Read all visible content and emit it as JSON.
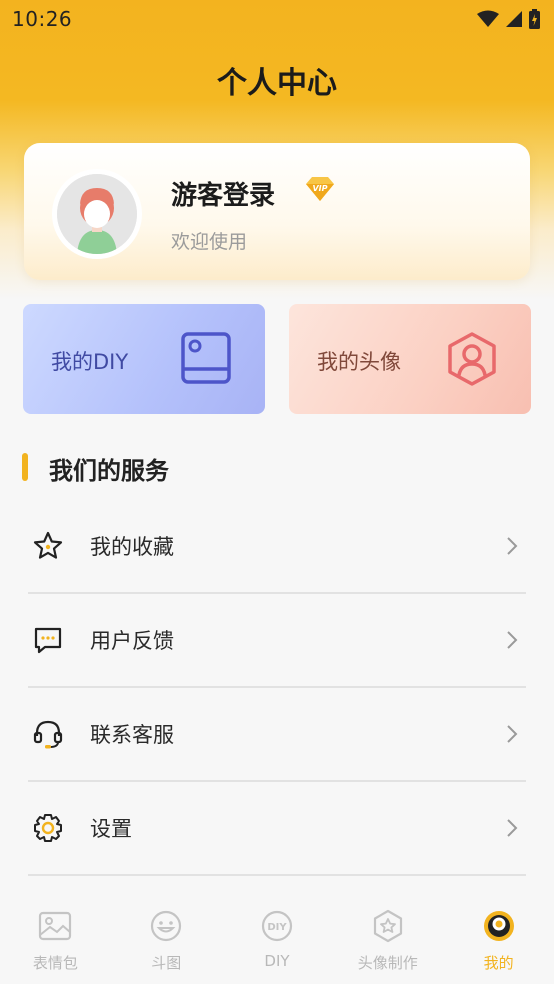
{
  "status_bar": {
    "time": "10:26"
  },
  "header": {
    "title": "个人中心"
  },
  "profile": {
    "name": "游客登录",
    "badge": "VIP",
    "subtitle": "欢迎使用"
  },
  "quick_cards": [
    {
      "label": "我的DIY",
      "icon": "photo-frame-icon"
    },
    {
      "label": "我的头像",
      "icon": "user-hexagon-icon"
    }
  ],
  "services": {
    "title": "我们的服务",
    "items": [
      {
        "label": "我的收藏",
        "icon": "star-icon"
      },
      {
        "label": "用户反馈",
        "icon": "chat-bubble-icon"
      },
      {
        "label": "联系客服",
        "icon": "headset-icon"
      },
      {
        "label": "设置",
        "icon": "gear-icon"
      }
    ]
  },
  "tabs": [
    {
      "label": "表情包",
      "icon": "image-icon",
      "active": false
    },
    {
      "label": "斗图",
      "icon": "smile-face-icon",
      "active": false
    },
    {
      "label": "DIY",
      "icon": "diy-circle-icon",
      "active": false
    },
    {
      "label": "头像制作",
      "icon": "star-hexagon-icon",
      "active": false
    },
    {
      "label": "我的",
      "icon": "user-circle-icon",
      "active": true
    }
  ],
  "colors": {
    "accent": "#f2b31f",
    "diy_text": "#404aa3",
    "avatar_text": "#80483a"
  }
}
